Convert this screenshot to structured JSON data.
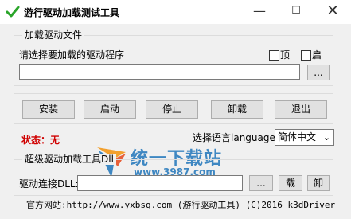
{
  "window": {
    "title": "游行驱动加载测试工具",
    "minimize_glyph": "—",
    "maximize_glyph": "☐",
    "close_glyph": "✕"
  },
  "driver_file_group": {
    "title": "加载驱动文件",
    "prompt": "请选择要加载的驱动程序",
    "checkbox_top_label": "顶",
    "checkbox_start_label": "启",
    "path_value": "",
    "browse_label": "..."
  },
  "actions": {
    "install": "安装",
    "start": "启动",
    "stop": "停止",
    "uninstall": "卸载",
    "exit": "退出"
  },
  "status": {
    "text": "状态：无"
  },
  "language": {
    "label": "选择语言language:",
    "selected": "简体中文"
  },
  "advanced_group": {
    "title": "超级驱动加载工具Dll",
    "dll_label": "驱动连接DLL:",
    "dll_value": "",
    "browse_label": "...",
    "load_label": "载",
    "unload_label": "卸"
  },
  "footer": {
    "text": "官方网站:http://www.yxbsq.com (游行驱动工具) (C)2016 k3dDriver"
  },
  "watermark": {
    "brand": "统一下载站",
    "url": "www.3987.com"
  },
  "colors": {
    "status_red": "#d00000",
    "watermark_blue": "#2f7fbf",
    "app_icon_green": "#2aa52a"
  }
}
